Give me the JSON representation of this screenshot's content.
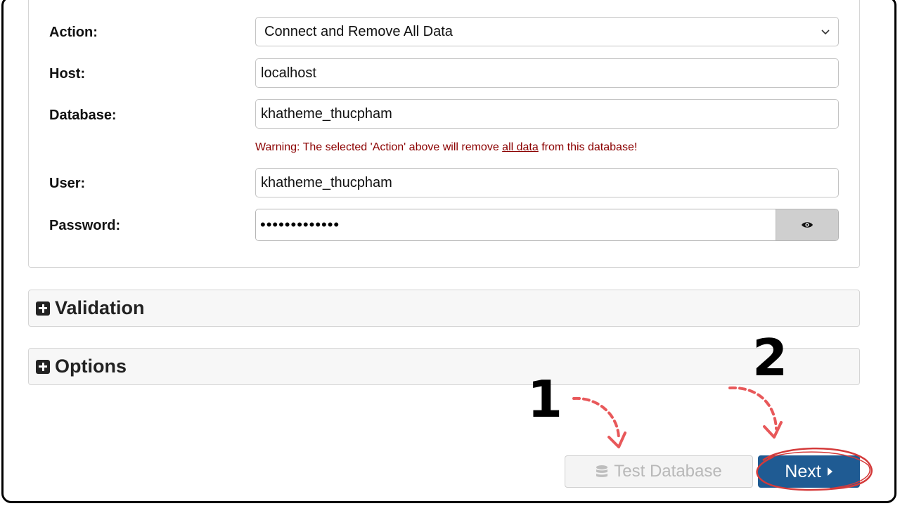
{
  "form": {
    "action": {
      "label": "Action:",
      "value": "Connect and Remove All Data"
    },
    "host": {
      "label": "Host:",
      "value": "localhost"
    },
    "database": {
      "label": "Database:",
      "value": "khatheme_thucpham"
    },
    "warning": {
      "prefix": "Warning: The selected 'Action' above will remove ",
      "link": "all data",
      "suffix": " from this database!"
    },
    "user": {
      "label": "User:",
      "value": "khatheme_thucpham"
    },
    "password": {
      "label": "Password:",
      "value": "•••••••••••••",
      "toggle_icon": "eye-icon"
    }
  },
  "sections": [
    {
      "title": "Validation",
      "icon": "plus-square-icon"
    },
    {
      "title": "Options",
      "icon": "plus-square-icon"
    }
  ],
  "buttons": {
    "test_database": {
      "label": "Test Database",
      "icon": "database-icon",
      "enabled": false
    },
    "next": {
      "label": "Next",
      "icon": "caret-right-icon"
    }
  },
  "annotations": {
    "step1": "1",
    "step2": "2"
  },
  "colors": {
    "primary": "#1f5b93",
    "warning": "#8b0000",
    "annotation": "#e8585a"
  }
}
